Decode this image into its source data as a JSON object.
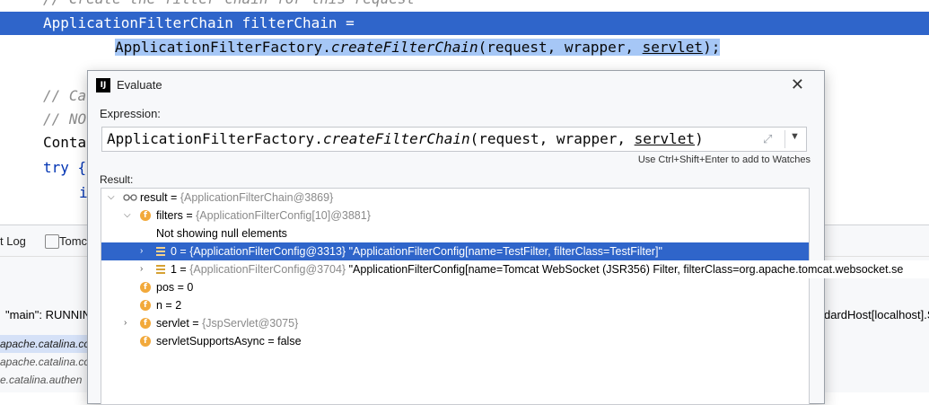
{
  "editor": {
    "line_comment_top": "// Create the filter chain for this request",
    "line1": "ApplicationFilterChain filterChain =",
    "line2_a": "ApplicationFilterFactory.",
    "line2_b": "createFilterChain",
    "line2_c": "(request, wrapper, ",
    "line2_d": "servlet",
    "line2_e": ");",
    "line_c1": "// Ca",
    "line_c2": "// NO",
    "line_cont": "Conta",
    "line_try": "try {",
    "line_i": "i"
  },
  "toolwindow": {
    "tab_log": "t Log",
    "tab_tomcat": "Tomca",
    "thread_text": "\"main\": RUNNIN",
    "frames": [
      "apache.catalina.co",
      "apache.catalina.core",
      "e.catalina.authen"
    ],
    "right_text": "dardHost[localhost].St"
  },
  "dialog": {
    "logo": "IJ",
    "title": "Evaluate",
    "close": "✕",
    "expression_label": "Expression:",
    "expr_a": "ApplicationFilterFactory.",
    "expr_b": "createFilterChain",
    "expr_c": "(request, wrapper, ",
    "expr_d": "servlet",
    "expr_e": ")",
    "hint": "Use Ctrl+Shift+Enter to add to Watches",
    "result_label": "Result:"
  },
  "tree": {
    "result_name": "result = ",
    "result_value": "{ApplicationFilterChain@3869}",
    "filters_name": "filters = ",
    "filters_value": "{ApplicationFilterConfig[10]@3881}",
    "not_showing": "Not showing null elements",
    "item0_name": "0 = ",
    "item0_value": "{ApplicationFilterConfig@3313}",
    "item0_str": " \"ApplicationFilterConfig[name=TestFilter, filterClass=TestFilter]\"",
    "item1_name": "1 = ",
    "item1_value": "{ApplicationFilterConfig@3704}",
    "item1_str": " \"ApplicationFilterConfig[name=Tomcat WebSocket (JSR356) Filter, filterClass=org.apache.tomcat.websocket.se",
    "pos": "pos = 0",
    "n": "n = 2",
    "servlet_name": "servlet = ",
    "servlet_value": "{JspServlet@3075}",
    "async": "servletSupportsAsync = false"
  }
}
